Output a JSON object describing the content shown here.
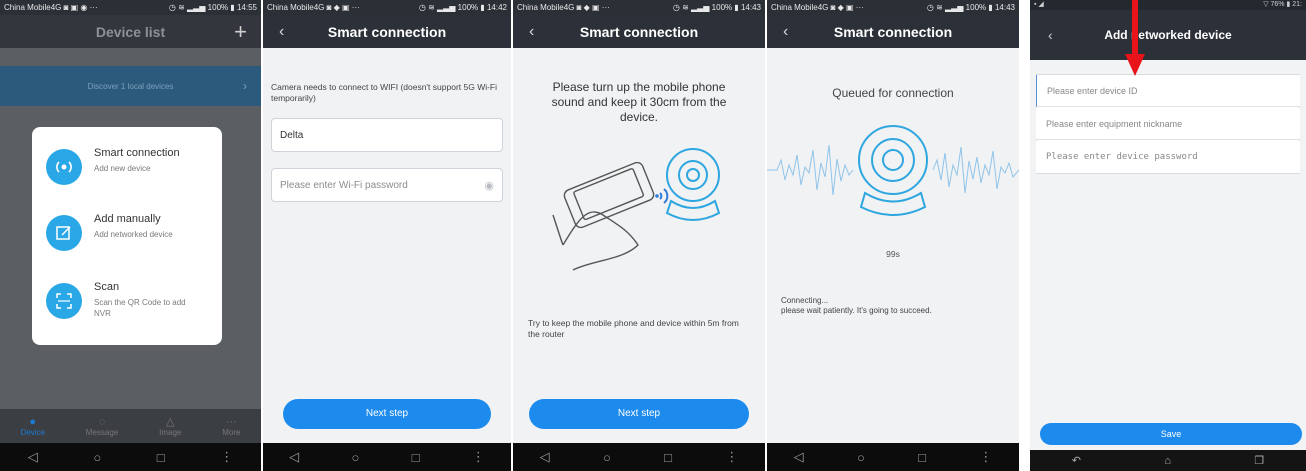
{
  "screen1": {
    "status_left": "China Mobile4G ◙ ▣ ◉ ···",
    "status_right": "◷ ≋ ▂▃▅ 100% ▮ 14:55",
    "title": "Device list",
    "add_icon": "plus-icon",
    "discover_text": "Discover  1  local devices",
    "menu": [
      {
        "icon": "broadcast-icon",
        "title": "Smart connection",
        "sub": "Add new device"
      },
      {
        "icon": "edit-square-icon",
        "title": "Add manually",
        "sub": "Add networked device"
      },
      {
        "icon": "scan-icon",
        "title": "Scan",
        "sub": "Scan the QR Code to add NVR"
      }
    ],
    "tabs": [
      {
        "icon": "person-icon",
        "label": "Device"
      },
      {
        "icon": "message-icon",
        "label": "Message"
      },
      {
        "icon": "image-icon",
        "label": "Image"
      },
      {
        "icon": "more-icon",
        "label": "More"
      }
    ]
  },
  "screen2": {
    "status_left": "China Mobile4G ◙ ◆ ▣ ···",
    "status_right": "◷ ≋ ▂▃▅ 100% ▮ 14:42",
    "title": "Smart connection",
    "info": "Camera needs to connect to WIFI (doesn't support 5G Wi-Fi temporarily)",
    "wifi_name": "Delta",
    "password_placeholder": "Please enter Wi-Fi password",
    "next": "Next step"
  },
  "screen3": {
    "status_left": "China Mobile4G ◙ ◆ ▣ ···",
    "status_right": "◷ ≋ ▂▃▅ 100% ▮ 14:43",
    "title": "Smart connection",
    "instruction": "Please turn up the mobile phone sound and keep it 30cm from the device.",
    "tip": "Try to keep the mobile phone and device within 5m from the router",
    "next": "Next step"
  },
  "screen4": {
    "status_left": "China Mobile4G ◙ ◆ ▣ ···",
    "status_right": "◷ ≋ ▂▃▅ 100% ▮ 14:43",
    "title": "Smart connection",
    "queued": "Queued for connection",
    "countdown": "99s",
    "connecting": "Connecting...",
    "wait": "please wait patiently. It's going to succeed."
  },
  "screen5": {
    "status_right": "▽ 76% ▮ 21:",
    "title": "Add networked device",
    "device_id_placeholder": "Please enter device ID",
    "nickname_placeholder": "Please enter equipment nickname",
    "password_placeholder": "Please enter device password",
    "save": "Save"
  },
  "colors": {
    "accent": "#1d8bed",
    "topbar": "#2c3139",
    "annotation_arrow": "#e8141a"
  }
}
